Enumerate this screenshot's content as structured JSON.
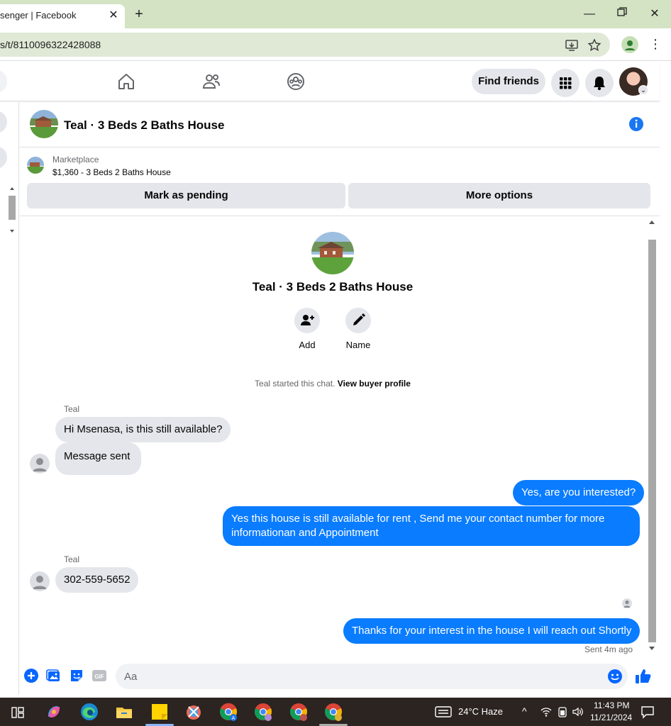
{
  "browser": {
    "tab_title": "senger | Facebook",
    "url": "s/t/8110096322428088"
  },
  "nav": {
    "find_friends": "Find friends"
  },
  "chat": {
    "title": "Teal · 3 Beds 2 Baths House"
  },
  "marketplace": {
    "label": "Marketplace",
    "listing": "$1,360 - 3 Beds 2 Baths House",
    "mark_pending": "Mark as pending",
    "more_options": "More options"
  },
  "hero": {
    "title": "Teal · 3 Beds 2 Baths House",
    "add_label": "Add",
    "name_label": "Name"
  },
  "system": {
    "started": "Teal started this chat.",
    "view_profile": "View buyer profile"
  },
  "messages": {
    "sender1": "Teal",
    "m1": "Hi Msenasa, is this still available?",
    "m2": "Message sent",
    "m3": "Yes, are you interested?",
    "m4": "Yes this house is still available for rent , Send me your contact number for more informationan and Appointment",
    "sender2": "Teal",
    "m5": "302-559-5652",
    "m6": "Thanks for your interest in the house I will reach out Shortly",
    "sent_status": "Sent 4m ago"
  },
  "composer": {
    "placeholder": "Aa"
  },
  "taskbar": {
    "weather": "24°C  Haze",
    "time": "11:43 PM",
    "date": "11/21/2024"
  },
  "colors": {
    "messenger_blue": "#0a7cff",
    "fb_blue": "#1877f2",
    "bubble_gray": "#e4e6eb"
  }
}
